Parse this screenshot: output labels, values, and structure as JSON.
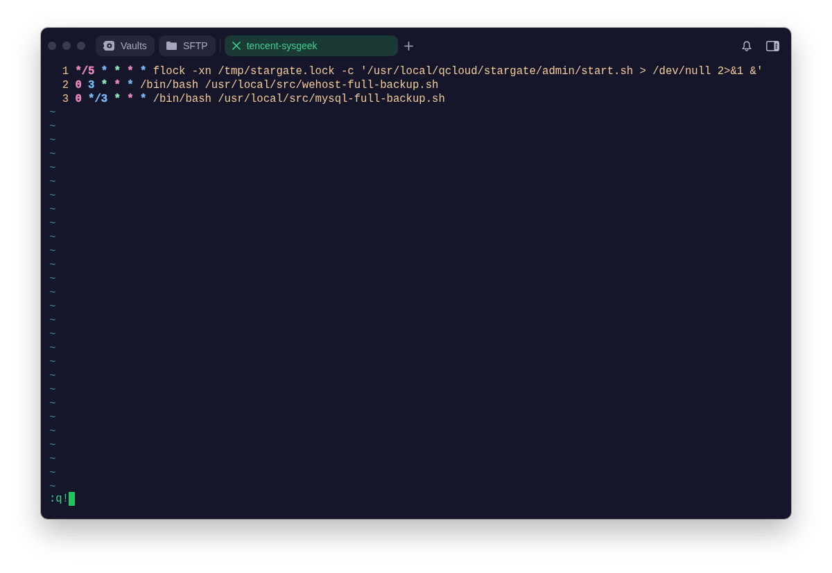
{
  "window": {
    "tabs": [
      {
        "kind": "vaults",
        "label": "Vaults",
        "selected": false
      },
      {
        "kind": "sftp",
        "label": "SFTP",
        "selected": false
      },
      {
        "kind": "host",
        "label": "tencent-sysgeek",
        "selected": true
      }
    ]
  },
  "editor": {
    "lines": [
      {
        "number": "1",
        "fields": [
          {
            "text": "*/5",
            "color": "#f08bc0"
          },
          {
            "text": "*",
            "color": "#7ab8f5"
          },
          {
            "text": "*",
            "color": "#8ee6bf"
          },
          {
            "text": "*",
            "color": "#f08bc0"
          },
          {
            "text": "*",
            "color": "#7ab8f5"
          }
        ],
        "command": "flock -xn /tmp/stargate.lock -c '/usr/local/qcloud/stargate/admin/start.sh > /dev/null 2>&1 &'"
      },
      {
        "number": "2",
        "fields": [
          {
            "text": "0",
            "color": "#f08bc0"
          },
          {
            "text": "3",
            "color": "#7ab8f5"
          },
          {
            "text": "*",
            "color": "#8ee6bf"
          },
          {
            "text": "*",
            "color": "#f08bc0"
          },
          {
            "text": "*",
            "color": "#7ab8f5"
          }
        ],
        "command": "/bin/bash /usr/local/src/wehost-full-backup.sh"
      },
      {
        "number": "3",
        "fields": [
          {
            "text": "0",
            "color": "#f08bc0"
          },
          {
            "text": "*/3",
            "color": "#7ab8f5"
          },
          {
            "text": "*",
            "color": "#8ee6bf"
          },
          {
            "text": "*",
            "color": "#f08bc0"
          },
          {
            "text": "*",
            "color": "#7ab8f5"
          }
        ],
        "command": "/bin/bash /usr/local/src/mysql-full-backup.sh"
      }
    ],
    "filler_lines": [
      "~",
      "~",
      "~",
      "~",
      "~",
      "~",
      "~",
      "~",
      "~",
      "~",
      "~",
      "~",
      "~",
      "~",
      "~",
      "~",
      "~",
      "~",
      "~",
      "~",
      "~",
      "~",
      "~",
      "~",
      "~",
      "~",
      "~",
      "~"
    ],
    "command_line": ":q!"
  }
}
